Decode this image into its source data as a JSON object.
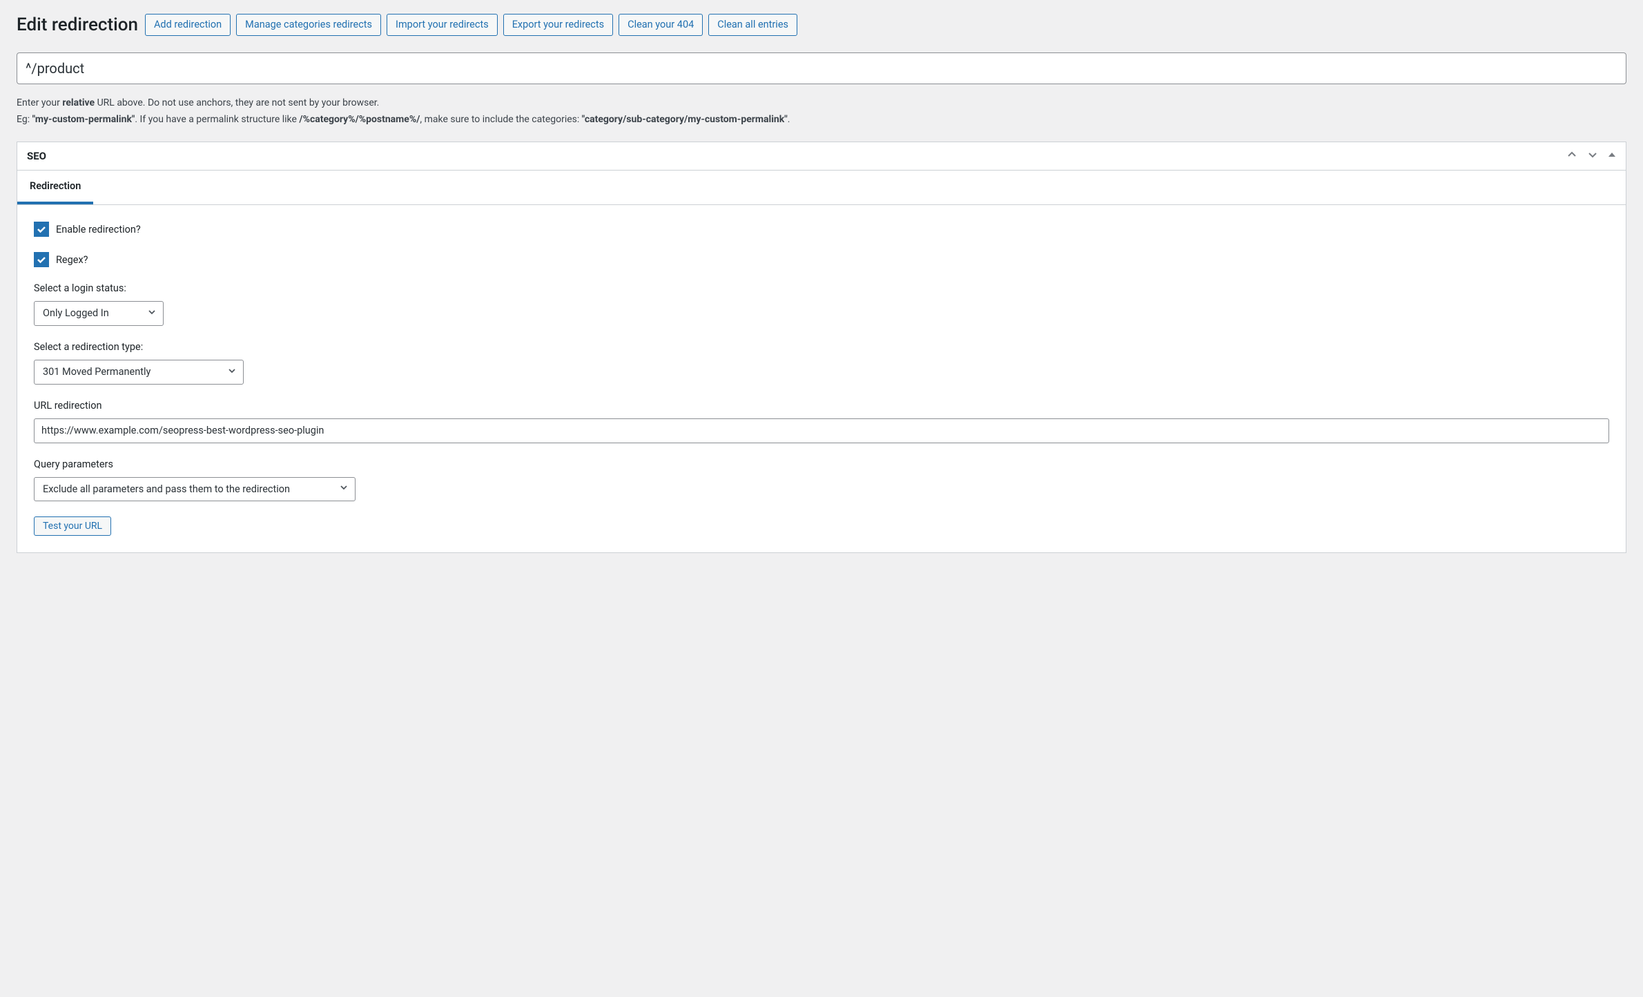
{
  "header": {
    "title": "Edit redirection",
    "buttons": {
      "add": "Add redirection",
      "manage_categories": "Manage categories redirects",
      "import": "Import your redirects",
      "export": "Export your redirects",
      "clean_404": "Clean your 404",
      "clean_all": "Clean all entries"
    }
  },
  "url_field": {
    "value": "^/product"
  },
  "help": {
    "line1_prefix": "Enter your ",
    "line1_strong": "relative",
    "line1_suffix": " URL above. Do not use anchors, they are not sent by your browser.",
    "line2_prefix": "Eg: ",
    "line2_strong1": "\"my-custom-permalink\"",
    "line2_mid1": ". If you have a permalink structure like ",
    "line2_strong2": "/%category%/%postname%/",
    "line2_mid2": ", make sure to include the categories: ",
    "line2_strong3": "\"category/sub-category/my-custom-permalink\"",
    "line2_end": "."
  },
  "panel": {
    "title": "SEO",
    "tab": "Redirection"
  },
  "form": {
    "enable_label": "Enable redirection?",
    "regex_label": "Regex?",
    "login_status_label": "Select a login status:",
    "login_status_value": "Only Logged In",
    "redirect_type_label": "Select a redirection type:",
    "redirect_type_value": "301 Moved Permanently",
    "url_redirect_label": "URL redirection",
    "url_redirect_value": "https://www.example.com/seopress-best-wordpress-seo-plugin",
    "query_params_label": "Query parameters",
    "query_params_value": "Exclude all parameters and pass them to the redirection",
    "test_url_label": "Test your URL"
  }
}
